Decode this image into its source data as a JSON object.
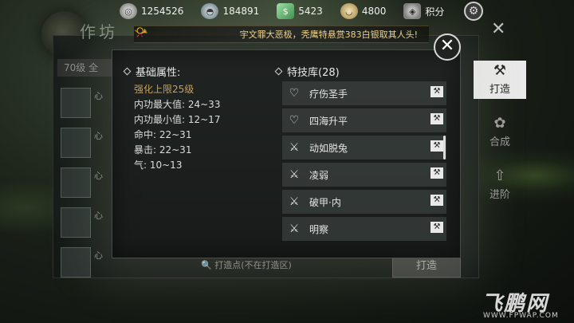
{
  "resources": [
    {
      "icon": "film-reel-icon",
      "value": "1254526"
    },
    {
      "icon": "pot-icon",
      "value": "184891"
    },
    {
      "icon": "banknote-icon",
      "value": "5423"
    },
    {
      "icon": "bowl-icon",
      "value": "4800"
    },
    {
      "icon": "shield-icon",
      "value": "积分"
    }
  ],
  "announcement": "宇文罪大恶极，秃鹰特悬赏383白银取其人头!",
  "underlying": {
    "title": "作坊",
    "level_filter": "70级  全",
    "items": [
      "心",
      "心",
      "心",
      "心",
      "心"
    ],
    "search_placeholder": "打造点(不在打造区)",
    "craft_button": "打造"
  },
  "sidenav": [
    {
      "label": "打造",
      "active": true
    },
    {
      "label": "合成",
      "active": false
    },
    {
      "label": "进阶",
      "active": false
    }
  ],
  "dialog": {
    "left_title": "基础属性:",
    "upgrade_limit": "强化上限25级",
    "attributes": [
      "内功最大值: 24~33",
      "内功最小值: 12~17",
      "命中: 22~31",
      "暴击: 22~31",
      "气: 10~13"
    ],
    "right_title": "特技库(28)",
    "skills": [
      {
        "name": "疗伤圣手",
        "icon": "heart-cross-icon"
      },
      {
        "name": "四海升平",
        "icon": "heart-cross-icon"
      },
      {
        "name": "动如脱兔",
        "icon": "sword-icon"
      },
      {
        "name": "凌弱",
        "icon": "sword-icon"
      },
      {
        "name": "破甲·内",
        "icon": "sword-icon"
      },
      {
        "name": "明察",
        "icon": "sword-icon"
      }
    ]
  },
  "watermark": {
    "main": "飞鹏网",
    "url": "WWW.FPWAP.COM"
  }
}
